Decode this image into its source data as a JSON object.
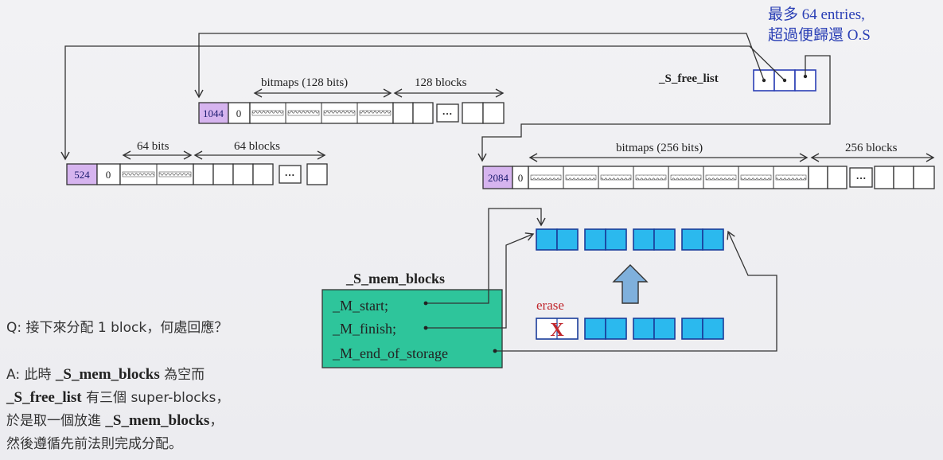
{
  "note": {
    "line1": "最多 64 entries,",
    "line2": "超過便歸還 O.S"
  },
  "free_list": {
    "label": "_S_free_list"
  },
  "blocks": {
    "b1044": {
      "header": "1044",
      "zero": "0",
      "bitmap_label": "bitmaps (128 bits)",
      "blocks_label": "128 blocks",
      "dots": "···"
    },
    "b524": {
      "header": "524",
      "zero": "0",
      "bitmap_label": "64 bits",
      "blocks_label": "64 blocks",
      "dots": "···"
    },
    "b2084": {
      "header": "2084",
      "zero": "0",
      "bitmap_label": "bitmaps (256 bits)",
      "blocks_label": "256 blocks",
      "dots": "···"
    }
  },
  "mem_blocks": {
    "title": "_S_mem_blocks",
    "start": "_M_start;",
    "finish": "_M_finish;",
    "end": "_M_end_of_storage"
  },
  "erase": {
    "label": "erase",
    "mark": "X"
  },
  "question": "Q: 接下來分配 1 block，何處回應？",
  "answer": {
    "l1_a": "A: 此時 ",
    "l1_b": "_S_mem_blocks",
    "l1_c": " 為空而",
    "l2_a": "_S_free_list",
    "l2_b": " 有三個 super-blocks，",
    "l3_a": "於是取一個放進 ",
    "l3_b": "_S_mem_blocks",
    "l3_c": "，",
    "l4": "然後遵循先前法則完成分配。"
  },
  "colors": {
    "header_purple": "#d6b4ef",
    "accent_cyan": "#2bb9ee",
    "mem_green": "#2ec59b",
    "note_blue": "#2a3fb5",
    "erase_red": "#c0262c"
  }
}
